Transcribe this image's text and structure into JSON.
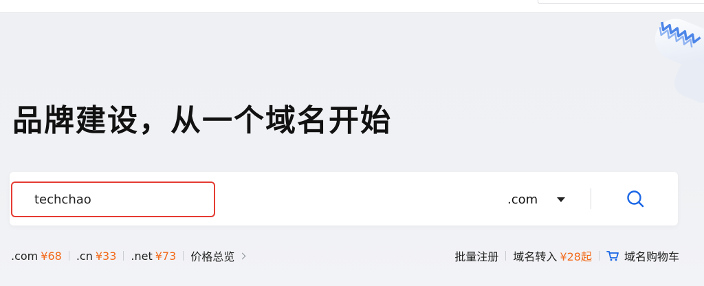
{
  "hero": {
    "title": "品牌建设，从一个域名开始"
  },
  "search": {
    "value": "techchao",
    "suffix": ".com",
    "icons": {
      "dropdown": "caret-down-icon",
      "search": "search-icon"
    }
  },
  "tld_prices": [
    {
      "tld": ".com",
      "price": "¥68"
    },
    {
      "tld": ".cn",
      "price": "¥33"
    },
    {
      "tld": ".net",
      "price": "¥73"
    }
  ],
  "price_overview": "价格总览",
  "right_links": {
    "bulk": "批量注册",
    "transfer": "域名转入",
    "transfer_price": "¥28起",
    "cart": "域名购物车",
    "cart_icon": "cart-icon"
  },
  "colors": {
    "accent_blue": "#1a66e6",
    "price_orange": "#f26a1b",
    "highlight_red": "#e43b32"
  }
}
